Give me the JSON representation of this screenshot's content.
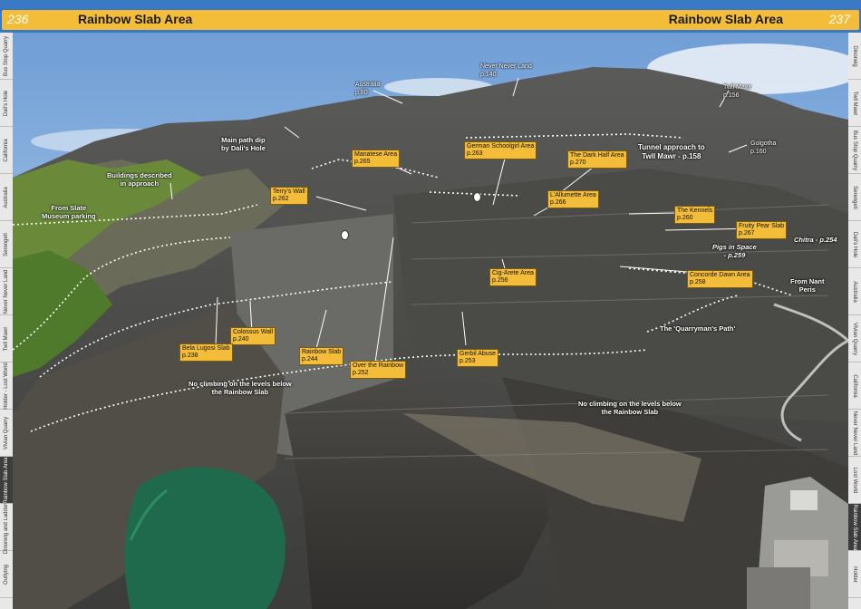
{
  "header": {
    "page_left": "236",
    "page_right": "237",
    "title_left": "Rainbow Slab Area",
    "title_right": "Rainbow Slab Area"
  },
  "left_tabs": [
    "Bus Stop Quarry",
    "Dali's Hole",
    "California",
    "Australia",
    "Serengeti",
    "Never Never Land",
    "Twll Mawr",
    "Holder - Lost World",
    "Vivian Quarry",
    "Rainbow Slab Area",
    "Dinorwig and Ladders",
    "Outlying"
  ],
  "right_tabs": [
    "Dinorwig",
    "Twll Mawr",
    "Bus Stop Quarry",
    "Serengeti",
    "Dali's Hole",
    "Australia",
    "Vivian Quarry",
    "California",
    "Never Never Land",
    "Lost World",
    "Rainbow Slab Area",
    "Holder"
  ],
  "labels": {
    "never_never_land": "Never Never Land",
    "never_never_land_page": "p.140",
    "australia": "Australia",
    "australia_page": "p.80",
    "twll_mawr": "Twll Mawr",
    "twll_mawr_page": "p.156",
    "golgotha": "Golgotha",
    "golgotha_page": "p.160",
    "german_schoolgirl": "German Schoolgirl Area",
    "german_schoolgirl_page": "p.263",
    "dark_half": "The Dark Half Area",
    "dark_half_page": "p.270",
    "manatese": "Manatese Area",
    "manatese_page": "p.265",
    "terrys_wall": "Terry's Wall",
    "terrys_wall_page": "p.262",
    "lallumette": "L'Allumette Area",
    "lallumette_page": "p.266",
    "kennels": "The Kennels",
    "kennels_page": "p.260",
    "fruity_pear": "Fruity Pear Slab",
    "fruity_pear_page": "p.267",
    "cig_arete": "Cig-Arete Area",
    "cig_arete_page": "p.256",
    "concorde": "Concorde Dawn Area",
    "concorde_page": "p.258",
    "colossus": "Colossus Wall",
    "colossus_page": "p.240",
    "bela": "Bela Lugosi Slab",
    "bela_page": "p.238",
    "rainbow": "Rainbow Slab",
    "rainbow_page": "p.244",
    "over_rainbow": "Over the Rainbow",
    "over_rainbow_page": "p.252",
    "gerbil": "Gerbil Abuse",
    "gerbil_page": "p.253"
  },
  "notes": {
    "main_path_1": "Main path dip",
    "main_path_2": "by Dali's Hole",
    "buildings_1": "Buildings described",
    "buildings_2": "in approach",
    "slate_1": "From Slate",
    "slate_2": "Museum parking",
    "tunnel_1": "Tunnel approach to",
    "tunnel_2": "Twll Mawr - p.158",
    "pigs_1": "Pigs in Space",
    "pigs_2": "- p.259",
    "chitra": "Chitra - p.254",
    "nant_1": "From Nant",
    "nant_2": "Peris",
    "quarrymans": "The 'Quarryman's Path'",
    "noclimb_left_1": "No climbing on the levels below",
    "noclimb_left_2": "the Rainbow Slab",
    "noclimb_right_1": "No climbing on the levels below",
    "noclimb_right_2": "the Rainbow Slab"
  },
  "colors": {
    "header_blue": "#3a78c4",
    "header_yellow": "#f3bd3a",
    "label_fill": "#f3bd3a",
    "path_line": "#ffffff",
    "water": "#1f6a4c"
  }
}
